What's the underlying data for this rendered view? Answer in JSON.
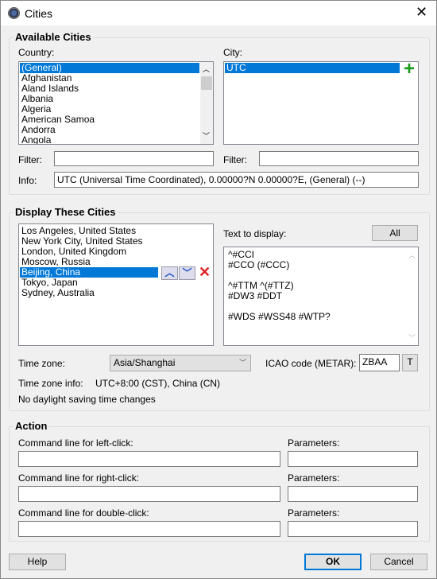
{
  "window": {
    "title": "Cities",
    "close": "✕"
  },
  "available": {
    "title": "Available Cities",
    "country_label": "Country:",
    "city_label": "City:",
    "countries": [
      "(General)",
      "Afghanistan",
      "Aland Islands",
      "Albania",
      "Algeria",
      "American Samoa",
      "Andorra",
      "Angola"
    ],
    "cities": [
      "UTC"
    ],
    "filter_label": "Filter:",
    "filter_value": "",
    "city_filter_label": "Filter:",
    "city_filter_value": "",
    "info_label": "Info:",
    "info_value": "UTC (Universal Time Coordinated), 0.00000?N  0.00000?E, (General) (--)"
  },
  "display": {
    "title": "Display These Cities",
    "cities": [
      "Los Angeles, United States",
      "New York City, United States",
      "London, United Kingdom",
      "Moscow, Russia",
      "Beijing, China",
      "Tokyo, Japan",
      "Sydney, Australia"
    ],
    "text_label": "Text to display:",
    "all_button": "All",
    "text_lines": [
      "^#CCI",
      "#CCO (#CCC)",
      "",
      "^#TTM ^(#TTZ)",
      "#DW3 #DDT",
      "",
      "#WDS #WSS48 #WTP?"
    ],
    "timezone_label": "Time zone:",
    "timezone_value": "Asia/Shanghai",
    "icao_label": "ICAO code (METAR):",
    "icao_value": "ZBAA",
    "t_button": "T",
    "tzinfo_label": "Time zone info:",
    "tzinfo_value": "UTC+8:00 (CST), China (CN)",
    "dst_text": "No daylight saving time changes"
  },
  "action": {
    "title": "Action",
    "rows": [
      {
        "label": "Command line for left-click:",
        "value": "",
        "params_label": "Parameters:",
        "params": ""
      },
      {
        "label": "Command line for right-click:",
        "value": "",
        "params_label": "Parameters:",
        "params": ""
      },
      {
        "label": "Command line for double-click:",
        "value": "",
        "params_label": "Parameters:",
        "params": ""
      }
    ]
  },
  "buttons": {
    "help": "Help",
    "ok": "OK",
    "cancel": "Cancel"
  }
}
